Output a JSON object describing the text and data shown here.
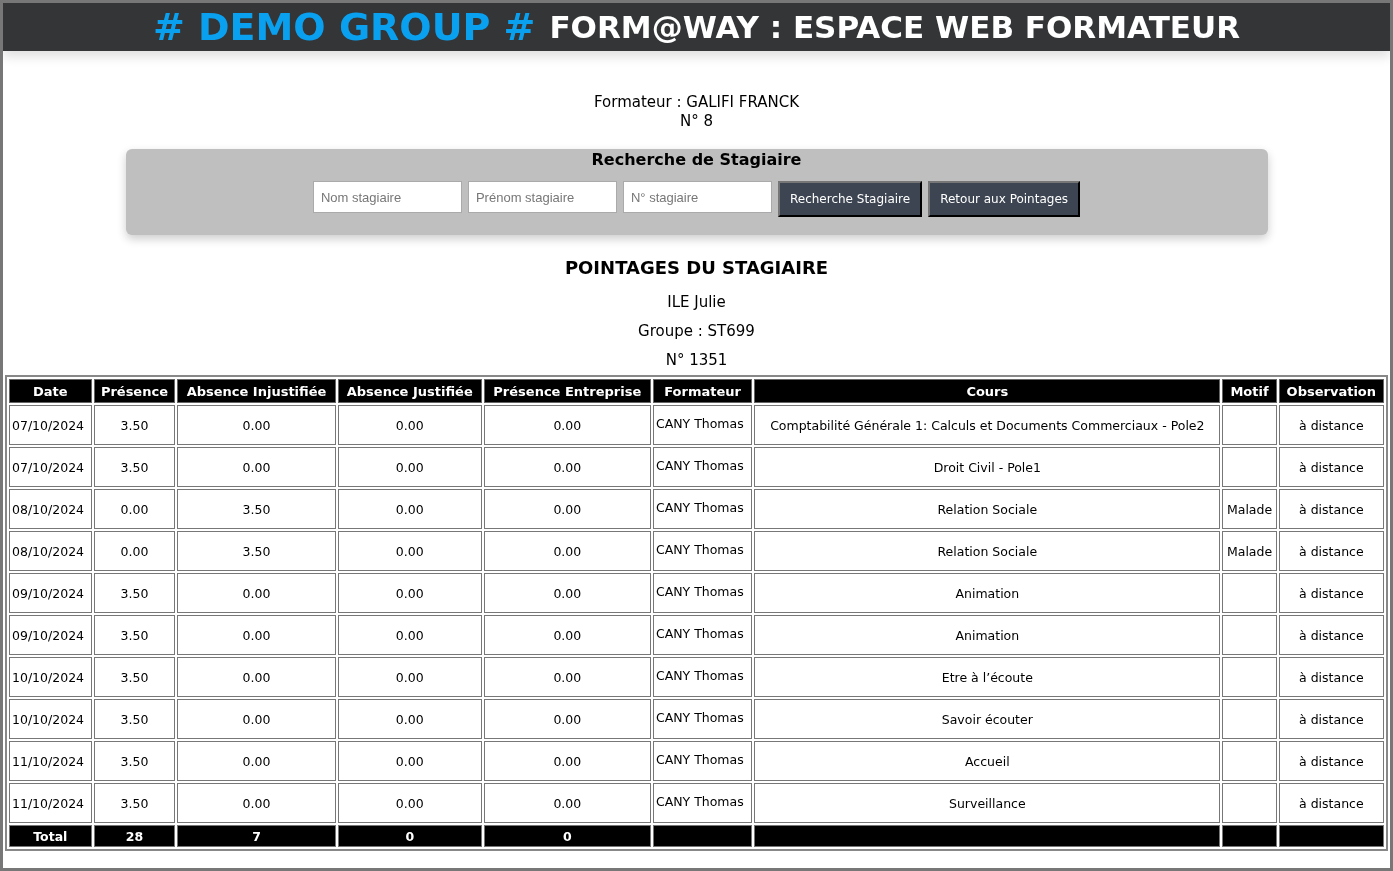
{
  "header": {
    "brand": "# DEMO GROUP #",
    "title": "FORM@WAY : ESPACE WEB FORMATEUR"
  },
  "trainer": {
    "name": "Formateur : GALIFI FRANCK",
    "number": "N° 8"
  },
  "search": {
    "title": "Recherche de Stagiaire",
    "fields": [
      {
        "placeholder": "Nom stagiaire"
      },
      {
        "placeholder": "Prénom stagiaire"
      },
      {
        "placeholder": "N° stagiaire"
      }
    ],
    "buttons": [
      "Recherche Stagiaire",
      "Retour aux Pointages"
    ]
  },
  "section_title": "POINTAGES DU STAGIAIRE",
  "trainee": {
    "name": "ILE Julie",
    "group": "Groupe : ST699",
    "number": "N° 1351"
  },
  "table": {
    "columns": [
      "Date",
      "Présence",
      "Absence Injustifiée",
      "Absence Justifiée",
      "Présence Entreprise",
      "Formateur",
      "Cours",
      "Motif",
      "Observation"
    ],
    "rows": [
      {
        "date": "07/10/2024",
        "presence": "3.50",
        "absence_injustifiee": "0.00",
        "absence_justifiee": "0.00",
        "presence_entreprise": "0.00",
        "formateur": "CANY Thomas",
        "cours": "Comptabilité Générale 1: Calculs et Documents Commerciaux - Pole2",
        "observation": "à distance"
      },
      {
        "date": "07/10/2024",
        "presence": "3.50",
        "absence_injustifiee": "0.00",
        "absence_justifiee": "0.00",
        "presence_entreprise": "0.00",
        "formateur": "CANY Thomas",
        "cours": "Droit Civil - Pole1",
        "observation": "à distance"
      },
      {
        "date": "08/10/2024",
        "presence": "0.00",
        "absence_injustifiee": "3.50",
        "absence_justifiee": "0.00",
        "presence_entreprise": "0.00",
        "formateur": "CANY Thomas",
        "cours": "Relation Sociale",
        "motif": "Malade",
        "observation": "à distance"
      },
      {
        "date": "08/10/2024",
        "presence": "0.00",
        "absence_injustifiee": "3.50",
        "absence_justifiee": "0.00",
        "presence_entreprise": "0.00",
        "formateur": "CANY Thomas",
        "cours": "Relation Sociale",
        "motif": "Malade",
        "observation": "à distance"
      },
      {
        "date": "09/10/2024",
        "presence": "3.50",
        "absence_injustifiee": "0.00",
        "absence_justifiee": "0.00",
        "presence_entreprise": "0.00",
        "formateur": "CANY Thomas",
        "cours": "Animation",
        "observation": "à distance"
      },
      {
        "date": "09/10/2024",
        "presence": "3.50",
        "absence_injustifiee": "0.00",
        "absence_justifiee": "0.00",
        "presence_entreprise": "0.00",
        "formateur": "CANY Thomas",
        "cours": "Animation",
        "observation": "à distance"
      },
      {
        "date": "10/10/2024",
        "presence": "3.50",
        "absence_injustifiee": "0.00",
        "absence_justifiee": "0.00",
        "presence_entreprise": "0.00",
        "formateur": "CANY Thomas",
        "cours": "Etre à l’écoute",
        "observation": "à distance"
      },
      {
        "date": "10/10/2024",
        "presence": "3.50",
        "absence_injustifiee": "0.00",
        "absence_justifiee": "0.00",
        "presence_entreprise": "0.00",
        "formateur": "CANY Thomas",
        "cours": "Savoir écouter",
        "observation": "à distance"
      },
      {
        "date": "11/10/2024",
        "presence": "3.50",
        "absence_injustifiee": "0.00",
        "absence_justifiee": "0.00",
        "presence_entreprise": "0.00",
        "formateur": "CANY Thomas",
        "cours": "Accueil",
        "observation": "à distance"
      },
      {
        "date": "11/10/2024",
        "presence": "3.50",
        "absence_injustifiee": "0.00",
        "absence_justifiee": "0.00",
        "presence_entreprise": "0.00",
        "formateur": "CANY Thomas",
        "cours": "Surveillance",
        "observation": "à distance"
      }
    ],
    "total": {
      "label": "Total",
      "values": [
        "28",
        "7",
        "0",
        "0"
      ]
    }
  }
}
